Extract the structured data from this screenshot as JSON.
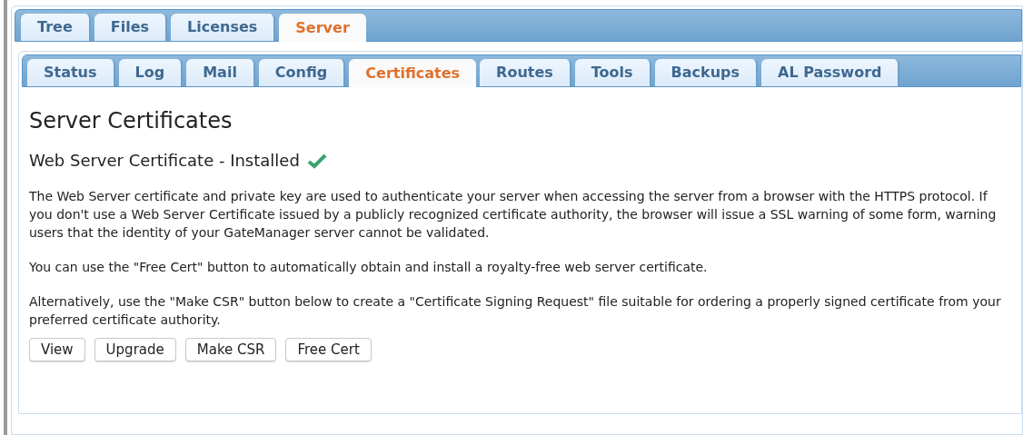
{
  "main_tabs": [
    {
      "label": "Tree",
      "selected": false
    },
    {
      "label": "Files",
      "selected": false
    },
    {
      "label": "Licenses",
      "selected": false
    },
    {
      "label": "Server",
      "selected": true
    }
  ],
  "server_tabs": [
    {
      "label": "Status",
      "selected": false
    },
    {
      "label": "Log",
      "selected": false
    },
    {
      "label": "Mail",
      "selected": false
    },
    {
      "label": "Config",
      "selected": false
    },
    {
      "label": "Certificates",
      "selected": true
    },
    {
      "label": "Routes",
      "selected": false
    },
    {
      "label": "Tools",
      "selected": false
    },
    {
      "label": "Backups",
      "selected": false
    },
    {
      "label": "AL Password",
      "selected": false
    }
  ],
  "heading": "Server Certificates",
  "subheading": {
    "text": "Web Server Certificate - Installed",
    "installed": true
  },
  "paragraphs": [
    "The Web Server certificate and private key are used to authenticate your server when accessing the server from a browser with the HTTPS protocol. If you don't use a Web Server Certificate issued by a publicly recognized certificate authority, the browser will issue a SSL warning of some form, warning users that the identity of your GateManager server cannot be validated.",
    "You can use the \"Free Cert\" button to automatically obtain and install a royalty-free web server certificate.",
    "Alternatively, use the \"Make CSR\" button below to create a \"Certificate Signing Request\" file suitable for ordering a properly signed certificate from your preferred certificate authority."
  ],
  "buttons": [
    "View",
    "Upgrade",
    "Make CSR",
    "Free Cert"
  ]
}
